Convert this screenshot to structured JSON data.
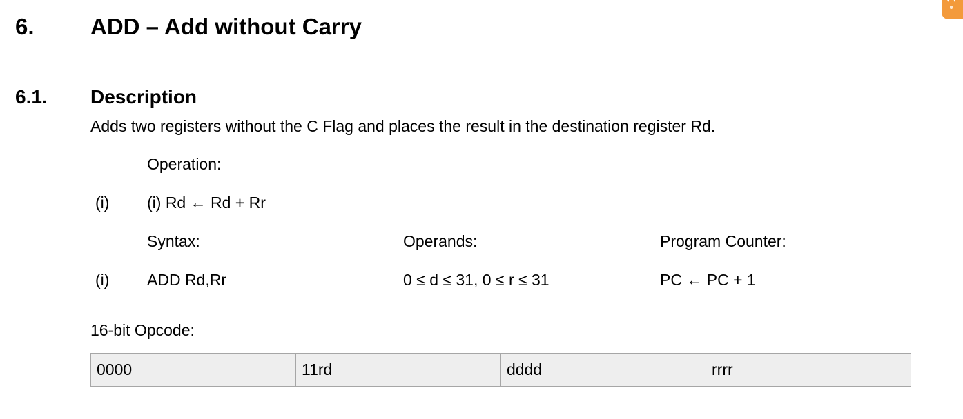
{
  "section": {
    "number": "6.",
    "title": "ADD – Add without Carry"
  },
  "subsection": {
    "number": "6.1.",
    "title": "Description"
  },
  "description": "Adds two registers without the C Flag and places the result in the destination register Rd.",
  "operation": {
    "label": "Operation:",
    "rows": [
      {
        "index": "(i)",
        "expression": "(i) Rd ← Rd + Rr"
      }
    ]
  },
  "syntax_table": {
    "headers": [
      "Syntax:",
      "Operands:",
      "Program Counter:"
    ],
    "rows": [
      {
        "index": "(i)",
        "syntax": "ADD Rd,Rr",
        "operands": "0 ≤ d ≤ 31, 0 ≤ r ≤ 31",
        "program_counter": "PC ← PC + 1"
      }
    ]
  },
  "opcode": {
    "label": "16-bit Opcode:",
    "cells": [
      "0000",
      "11rd",
      "dddd",
      "rrrr"
    ]
  },
  "colors": {
    "table_background": "#eeeeee",
    "table_border": "#a6a6a6",
    "badge": "#f39a3b"
  },
  "icons": {
    "corner_badge": "lightbulb-icon"
  }
}
